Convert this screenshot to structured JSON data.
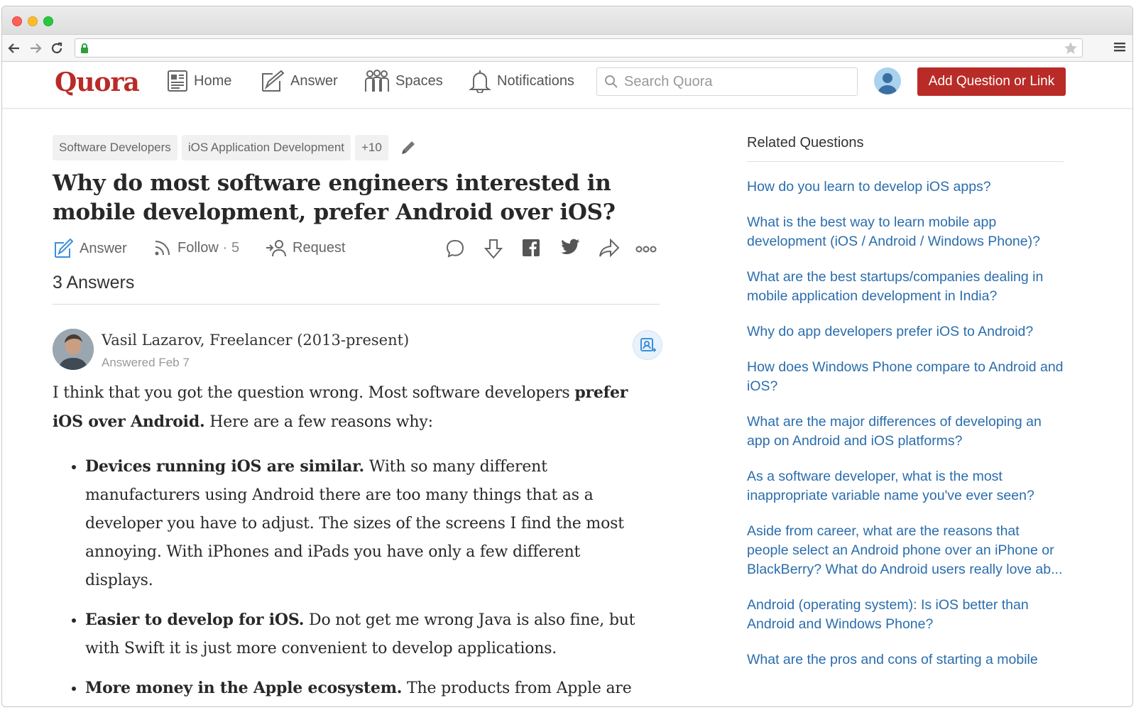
{
  "header": {
    "logo": "Quora",
    "nav": {
      "home": "Home",
      "answer": "Answer",
      "spaces": "Spaces",
      "notifications": "Notifications"
    },
    "search_placeholder": "Search Quora",
    "add_button": "Add Question or Link"
  },
  "question": {
    "topics": [
      "Software Developers",
      "iOS Application Development",
      "+10"
    ],
    "title": "Why do most software engineers interested in mobile development, prefer Android over iOS?",
    "actions": {
      "answer": "Answer",
      "follow": "Follow",
      "follow_count": "· 5",
      "request": "Request"
    },
    "answers_count": "3 Answers"
  },
  "answer": {
    "author": "Vasil Lazarov, Freelancer (2013-present)",
    "date": "Answered Feb 7",
    "intro_a": "I think that you got the question wrong. Most software developers ",
    "intro_bold": "prefer iOS over Android.",
    "intro_b": " Here are a few reasons why:",
    "bullets": [
      {
        "bold": "Devices running iOS are similar.",
        "text": " With so many different manufacturers using Android there are too many things that as a developer you have to adjust. The sizes of the screens I find the most annoying. With iPhones and iPads you have only a few different displays."
      },
      {
        "bold": "Easier to develop for iOS.",
        "text": " Do not get me wrong Java is also fine, but with Swift it is just more convenient to develop applications."
      },
      {
        "bold": "More money in the Apple ecosystem.",
        "text": " The products from Apple are"
      }
    ]
  },
  "sidebar": {
    "title": "Related Questions",
    "items": [
      "How do you learn to develop iOS apps?",
      "What is the best way to learn mobile app development (iOS / Android / Windows Phone)?",
      "What are the best startups/companies dealing in mobile application development in India?",
      "Why do app developers prefer iOS to Android?",
      "How does Windows Phone compare to Android and iOS?",
      "What are the major differences of developing an app on Android and iOS platforms?",
      "As a software developer, what is the most inappropriate variable name you've ever seen?",
      "Aside from career, what are the reasons that people select an Android phone over an iPhone or BlackBerry? What do Android users really love ab...",
      "Android (operating system): Is iOS better than Android and Windows Phone?",
      "What are the pros and cons of starting a mobile"
    ]
  },
  "colors": {
    "brand": "#b92b27",
    "link": "#2b6dad"
  }
}
